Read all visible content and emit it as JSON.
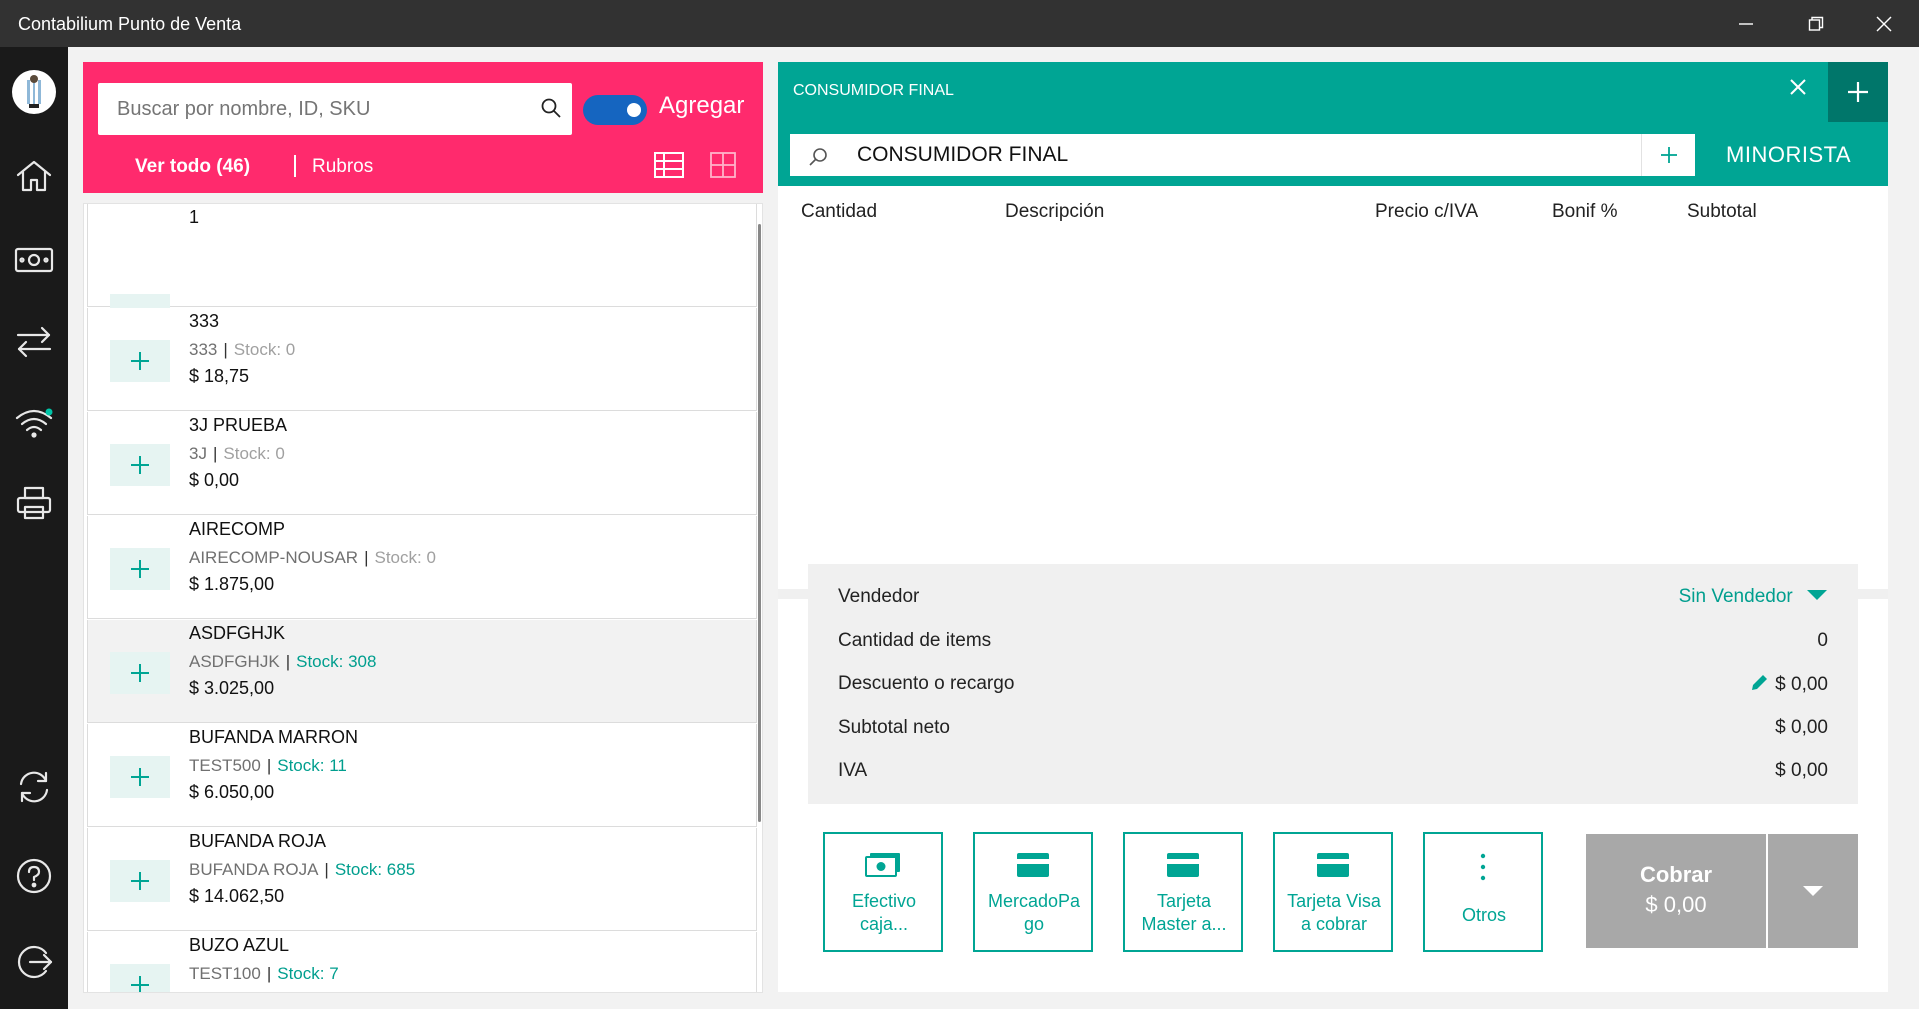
{
  "window": {
    "title": "Contabilium Punto de Venta"
  },
  "products": {
    "search_placeholder": "Buscar por nombre, ID, SKU",
    "toggle_label": "Agregar",
    "filter_all": "Ver todo (46)",
    "filter_rubros": "Rubros",
    "items": [
      {
        "name": "1",
        "code": "",
        "stock": "",
        "price": ""
      },
      {
        "name": "333",
        "code": "333",
        "stock": "Stock: 0",
        "price": "$ 18,75"
      },
      {
        "name": "3J PRUEBA",
        "code": "3J",
        "stock": "Stock: 0",
        "price": "$ 0,00"
      },
      {
        "name": "AIRECOMP",
        "code": "AIRECOMP-NOUSAR",
        "stock": "Stock: 0",
        "price": "$ 1.875,00"
      },
      {
        "name": "ASDFGHJK",
        "code": "ASDFGHJK",
        "stock": "Stock: 308",
        "price": "$ 3.025,00"
      },
      {
        "name": "BUFANDA MARRON",
        "code": "TEST500",
        "stock": "Stock: 11",
        "price": "$ 6.050,00"
      },
      {
        "name": "BUFANDA ROJA",
        "code": "BUFANDA ROJA",
        "stock": "Stock: 685",
        "price": "$ 14.062,50"
      },
      {
        "name": "BUZO AZUL",
        "code": "TEST100",
        "stock": "Stock: 7",
        "price": ""
      }
    ]
  },
  "sale": {
    "client_title": "CONSUMIDOR FINAL",
    "client_search_value": "CONSUMIDOR FINAL",
    "price_list": "MINORISTA",
    "columns": [
      "Cantidad",
      "Descripción",
      "Precio c/IVA",
      "Bonif %",
      "Subtotal"
    ],
    "summary": {
      "vendedor_label": "Vendedor",
      "vendedor_value": "Sin Vendedor",
      "cantidad_label": "Cantidad de items",
      "cantidad_value": "0",
      "descuento_label": "Descuento o recargo",
      "descuento_value": "$ 0,00",
      "subtotal_label": "Subtotal neto",
      "subtotal_value": "$ 0,00",
      "iva_label": "IVA",
      "iva_value": "$ 0,00"
    },
    "payments": {
      "efectivo_1": "Efectivo",
      "efectivo_2": "caja...",
      "mercadopago_1": "MercadoPa",
      "mercadopago_2": "go",
      "master_1": "Tarjeta",
      "master_2": "Master a...",
      "visa_1": "Tarjeta Visa",
      "visa_2": "a cobrar",
      "otros": "Otros"
    },
    "cobrar_label": "Cobrar",
    "cobrar_amount": "$ 0,00"
  },
  "colors": {
    "accent_pink": "#ff2a6d",
    "accent_teal": "#00a594",
    "teal_dark": "#00766a",
    "nav_bg": "#1a1a1a",
    "toggle_blue": "#1565c0"
  }
}
